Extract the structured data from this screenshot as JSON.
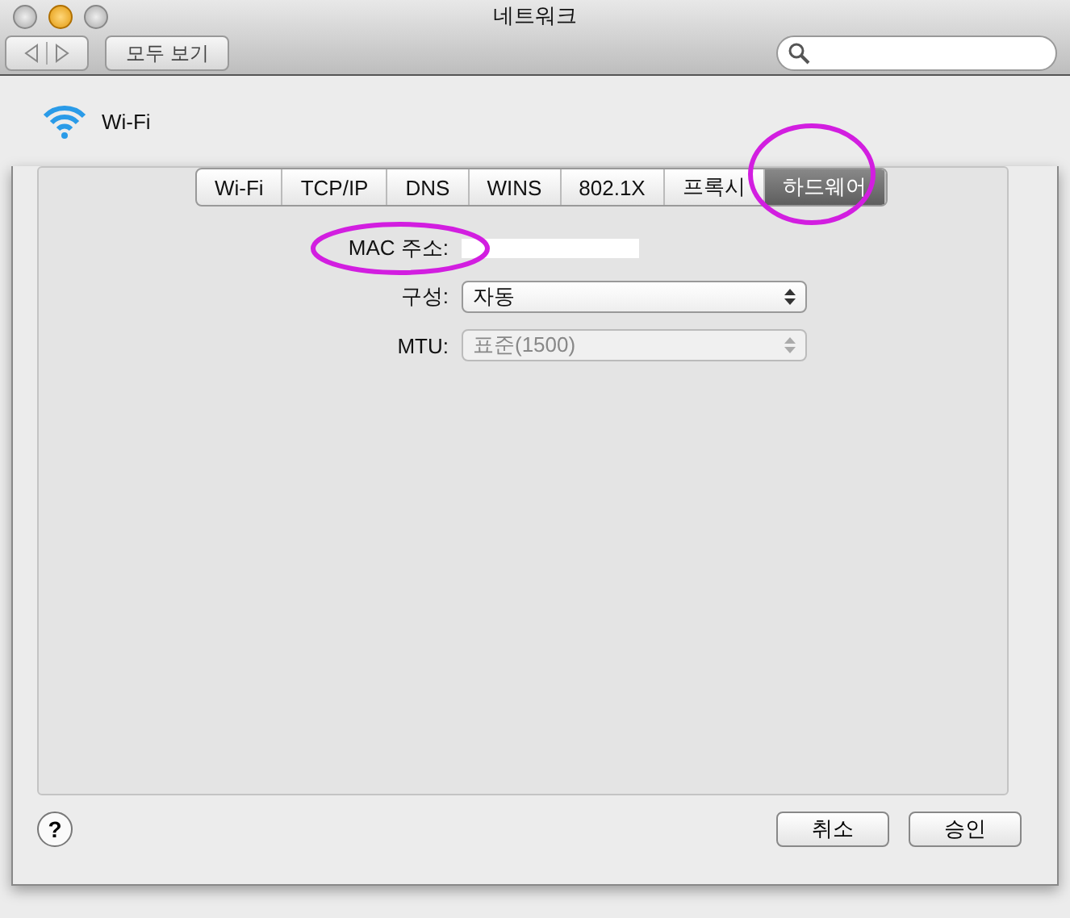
{
  "window": {
    "title": "네트워크"
  },
  "toolbar": {
    "show_all": "모두 보기"
  },
  "header": {
    "service": "Wi-Fi"
  },
  "sheet": {
    "tabs": [
      {
        "label": "Wi-Fi",
        "selected": false
      },
      {
        "label": "TCP/IP",
        "selected": false
      },
      {
        "label": "DNS",
        "selected": false
      },
      {
        "label": "WINS",
        "selected": false
      },
      {
        "label": "802.1X",
        "selected": false
      },
      {
        "label": "프록시",
        "selected": false
      },
      {
        "label": "하드웨어",
        "selected": true
      }
    ],
    "mac_label": "MAC 주소:",
    "fields": [
      {
        "label": "구성:",
        "value": "자동",
        "disabled": false
      },
      {
        "label": "MTU:",
        "value": "표준(1500)",
        "disabled": true
      }
    ],
    "help_mark": "?",
    "cancel": "취소",
    "ok": "승인"
  }
}
